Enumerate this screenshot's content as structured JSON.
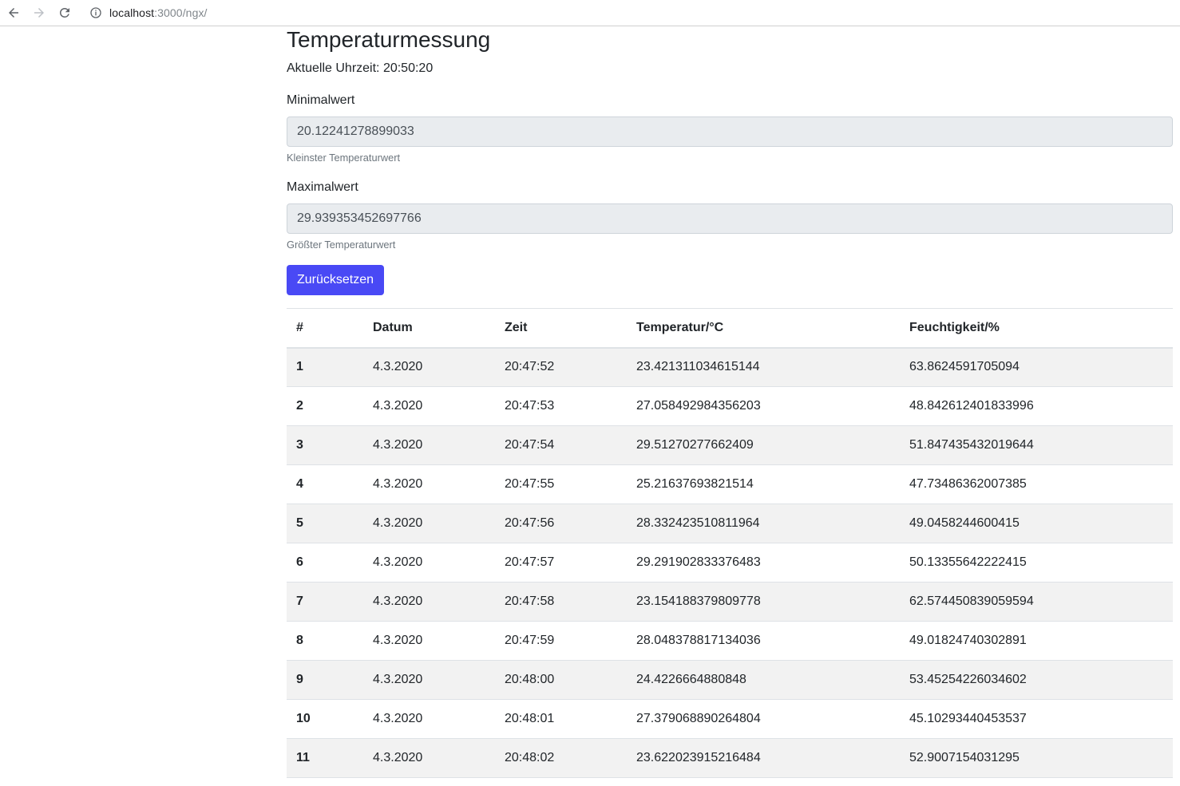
{
  "browser": {
    "url_host": "localhost",
    "url_rest": ":3000/ngx/"
  },
  "page": {
    "title": "Temperaturmessung",
    "clock_label": "Aktuelle Uhrzeit: 20:50:20"
  },
  "min_field": {
    "label": "Minimalwert",
    "value": "20.12241278899033",
    "help": "Kleinster Temperaturwert"
  },
  "max_field": {
    "label": "Maximalwert",
    "value": "29.939353452697766",
    "help": "Größter Temperaturwert"
  },
  "reset_button": {
    "label": "Zurücksetzen"
  },
  "table": {
    "headers": [
      "#",
      "Datum",
      "Zeit",
      "Temperatur/°C",
      "Feuchtigkeit/%"
    ],
    "rows": [
      [
        "1",
        "4.3.2020",
        "20:47:52",
        "23.421311034615144",
        "63.8624591705094"
      ],
      [
        "2",
        "4.3.2020",
        "20:47:53",
        "27.058492984356203",
        "48.842612401833996"
      ],
      [
        "3",
        "4.3.2020",
        "20:47:54",
        "29.51270277662409",
        "51.847435432019644"
      ],
      [
        "4",
        "4.3.2020",
        "20:47:55",
        "25.21637693821514",
        "47.73486362007385"
      ],
      [
        "5",
        "4.3.2020",
        "20:47:56",
        "28.332423510811964",
        "49.0458244600415"
      ],
      [
        "6",
        "4.3.2020",
        "20:47:57",
        "29.291902833376483",
        "50.13355642222415"
      ],
      [
        "7",
        "4.3.2020",
        "20:47:58",
        "23.154188379809778",
        "62.574450839059594"
      ],
      [
        "8",
        "4.3.2020",
        "20:47:59",
        "28.048378817134036",
        "49.01824740302891"
      ],
      [
        "9",
        "4.3.2020",
        "20:48:00",
        "24.4226664880848",
        "53.45254226034602"
      ],
      [
        "10",
        "4.3.2020",
        "20:48:01",
        "27.379068890264804",
        "45.10293440453537"
      ],
      [
        "11",
        "4.3.2020",
        "20:48:02",
        "23.622023915216484",
        "52.9007154031295"
      ]
    ]
  }
}
